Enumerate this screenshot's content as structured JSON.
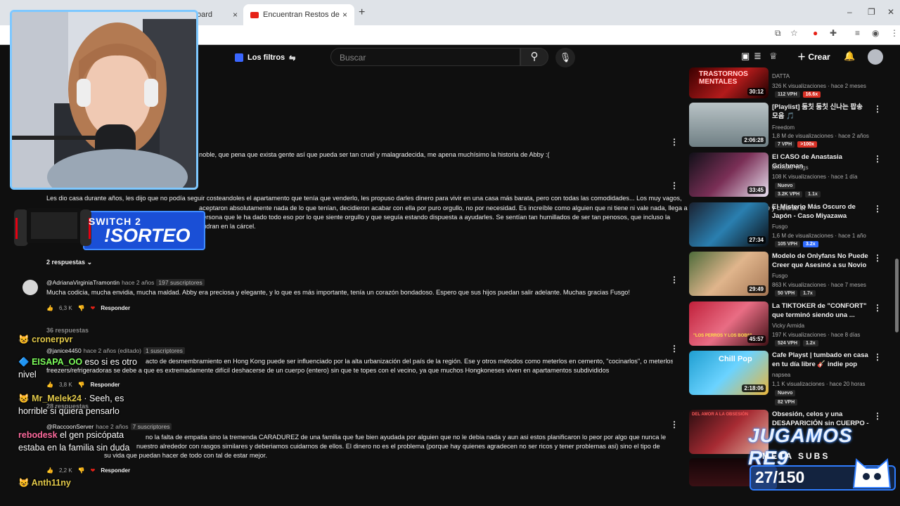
{
  "browser": {
    "tab1_title": "oard",
    "tab2_title": "Encuentran Restos de una Influ",
    "new_tab": "+",
    "close": "×"
  },
  "youtube_header": {
    "filters_label": "Los filtros",
    "search_placeholder": "Buscar",
    "create_label": "Crear"
  },
  "comments": [
    {
      "text_lines": [
        "noble, que pena que exista gente así que pueda ser tan cruel y malagradecida, me apena muchísimo la historia de Abby :("
      ]
    },
    {
      "text_lines": [
        "Les dio casa durante años, les dijo que no podía seguir costeandoles el apartamento que tenía que venderlo, les propuso darles dinero para vivir en una casa más barata, pero con todas las comodidades... Los muy vagos,",
        "aceptaron absolutamente nada de lo que tenían, decidieron acabar con ella por puro orgullo, no por necesidad. Es increíble como alguien que ni tiene ni vale nada, llega a adquirir un orgullo tan fuerte y creerse el",
        "persona que le ha dado todo eso por lo que siente orgullo y que seguía estando dispuesta a ayudarles. Se sentían tan humillados de ser tan penosos, que incluso la",
        "pudran en la cárcel."
      ],
      "replies": "2 respuestas"
    },
    {
      "author": "@AdrianaVirginiaTramontin",
      "time": "hace 2 años",
      "subs": "197 suscriptores",
      "text_lines": [
        "Mucha codicia, mucha envidia, mucha maldad. Abby era preciosa y elegante, y lo que es más importante, tenía un corazón bondadoso. Espero que sus hijos puedan salir adelante. Muchas gracias Fusgo!"
      ],
      "likes": "6,3 K",
      "reply_label": "Responder",
      "replies": "36 respuestas"
    },
    {
      "author": "@janice4450",
      "time": "hace 2 años (editado)",
      "subs": "1 suscriptores",
      "text_lines": [
        "acto de desmembramiento en Hong Kong puede ser influenciado por la alta urbanización del país de la región. Ese y otros métodos como meterlos en cemento, \"cocinarlos\", o meterlos en",
        "freezers/refrigeradoras se debe a que es extremadamente difícil deshacerse de un cuerpo (entero) sin que te topes con el vecino, ya que muchos Hongkoneses viven en apartamentos subdivididos"
      ],
      "likes": "3,8 K",
      "reply_label": "Responder",
      "replies": "28 respuestas"
    },
    {
      "author": "@RaccoonServer",
      "time": "hace 2 años",
      "subs": "7 suscriptores",
      "text_lines": [
        "no la falta de empatia sino la tremenda CARADUREZ de una familia que fue bien ayudada por alguien que no le debia nada y aun asi estos planificaron lo peor por algo que nunca les pertenecio,",
        "nuestro alrededor con rasgos similares y deberiamos cuidarnos de ellos. El dinero no es el problema (porque hay quienes agradecen no ser ricos y tener problemas asi) sino el tipo de",
        "su vida que puedan hacer de todo con tal de estar mejor."
      ],
      "likes": "2,2 K",
      "reply_label": "Responder"
    }
  ],
  "sidebar": [
    {
      "thumb_text": "TRASTORNOS MENTALES",
      "duration": "30:12",
      "title": "",
      "channel": "DATTA",
      "views": "326 K visualizaciones · hace 2 meses",
      "badges": [
        {
          "t": "112 VPH",
          "c": "gray"
        },
        {
          "t": "16.6x",
          "c": "red"
        }
      ]
    },
    {
      "thumb_text": "",
      "duration": "2:06:28",
      "title": "[Playlist] 둠칫 둠칫 신나는 팝송 모음 🎵",
      "channel": "Freedom",
      "views": "1,8 M de visualizaciones · hace 2 años",
      "badges": [
        {
          "t": "7 VPH",
          "c": "gray"
        },
        {
          "t": ">100x",
          "c": "red"
        }
      ]
    },
    {
      "thumb_text": "",
      "duration": "33:45",
      "title": "El CASO de Anastasia Grishman",
      "channel": "dinosaur vlogs",
      "views": "108 K visualizaciones · hace 1 día",
      "new": "Nuevo",
      "badges": [
        {
          "t": "3.2K VPH",
          "c": "gray"
        },
        {
          "t": "1.1x",
          "c": "gray"
        }
      ]
    },
    {
      "thumb_text": "",
      "duration": "27:34",
      "title": "El Misterio Más Oscuro de Japón - Caso Miyazawa",
      "channel": "Fusgo",
      "views": "1,6 M de visualizaciones · hace 1 año",
      "badges": [
        {
          "t": "105 VPH",
          "c": "gray"
        },
        {
          "t": "3.2x",
          "c": "blue"
        }
      ]
    },
    {
      "thumb_text": "",
      "duration": "29:49",
      "title": "Modelo de Onlyfans No Puede Creer que Asesinó a su Novio",
      "channel": "Fusgo",
      "views": "863 K visualizaciones · hace 7 meses",
      "badges": [
        {
          "t": "50 VPH",
          "c": "gray"
        },
        {
          "t": "1.7x",
          "c": "gray"
        }
      ]
    },
    {
      "thumb_text": "\"LOS PERROS Y LOS BOBS\"",
      "duration": "45:57",
      "title": "La TIKTOKER de \"CONFORT\" que terminó siendo una ...",
      "channel": "Vicky Armida",
      "views": "197 K visualizaciones · hace 8 días",
      "badges": [
        {
          "t": "524 VPH",
          "c": "gray"
        },
        {
          "t": "1.2x",
          "c": "gray"
        }
      ]
    },
    {
      "thumb_text": "Chill Pop",
      "duration": "2:18:06",
      "title": "Cafe Playst | tumbado en casa en tu día libre 🎸 indie pop chil...",
      "channel": "napsea",
      "views": "1,1 K visualizaciones · hace 20 horas",
      "new": "Nuevo",
      "badges": [
        {
          "t": "82 VPH",
          "c": "gray"
        }
      ]
    },
    {
      "thumb_text": "DEL AMOR A LA OBSESIÓN",
      "duration": "",
      "title": "Obsesión, celos y una DESAPARICIÓN sin CUERPO - ...",
      "channel": "",
      "views": "",
      "badges": []
    }
  ],
  "overlay": {
    "sorteo_small": "SWITCH 2",
    "sorteo_big": "!SORTEO",
    "chat": [
      {
        "user": "cronerpvr",
        "text": "",
        "color": "gold"
      },
      {
        "user": "EISAPA_OO",
        "text": " eso si es otro nivel",
        "color": "green"
      },
      {
        "user": "Mr_Melek24",
        "text": " · Seeh, es horrible si quiera pensarlo",
        "color": "gold"
      },
      {
        "user": "rebodesk",
        "text": " el gen psicópata estaba en la familia sin duda",
        "color": "pink"
      },
      {
        "user": "Anth11ny",
        "text": "",
        "color": "gold"
      }
    ],
    "goal_title": "JUGAMOS RE9",
    "goal_sub": "META SUBS",
    "goal_count": "27/150",
    "goal_current": 27,
    "goal_target": 150
  }
}
